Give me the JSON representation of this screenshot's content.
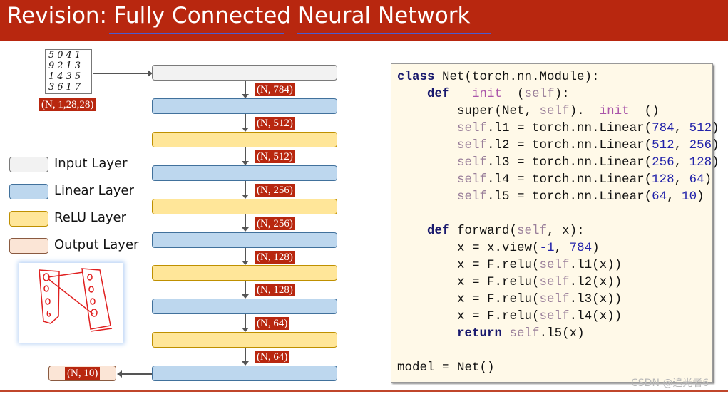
{
  "title": "Revision: Fully Connected Neural Network",
  "input_image": {
    "digit_rows": [
      "5041",
      "9213",
      "1435",
      "3617"
    ],
    "shape_label": "(N, 1,28,28)"
  },
  "layers": [
    {
      "type": "input"
    },
    {
      "type": "linear"
    },
    {
      "type": "relu"
    },
    {
      "type": "linear"
    },
    {
      "type": "relu"
    },
    {
      "type": "linear"
    },
    {
      "type": "relu"
    },
    {
      "type": "linear"
    },
    {
      "type": "relu"
    },
    {
      "type": "linear"
    }
  ],
  "shape_labels": [
    "(N, 784)",
    "(N, 512)",
    "(N, 512)",
    "(N, 256)",
    "(N, 256)",
    "(N, 128)",
    "(N, 128)",
    "(N, 64)",
    "(N, 64)"
  ],
  "output_label": "(N, 10)",
  "legend": [
    {
      "type": "input",
      "label": "Input Layer"
    },
    {
      "type": "linear",
      "label": "Linear Layer"
    },
    {
      "type": "relu",
      "label": "ReLU Layer"
    },
    {
      "type": "output",
      "label": "Output Layer"
    }
  ],
  "colors": {
    "title_bar": "#B8270F",
    "input": "#F2F2F2",
    "linear": "#BDD7EE",
    "relu": "#FFE699",
    "output": "#FBE5D6",
    "tag": "#B8270F",
    "sketch_ink": "#E02020"
  },
  "code": {
    "lines": [
      [
        [
          "class",
          "kw"
        ],
        [
          " Net(torch.nn.Module):",
          "plain"
        ]
      ],
      [
        [
          "    ",
          "plain"
        ],
        [
          "def",
          "kw"
        ],
        [
          " ",
          "plain"
        ],
        [
          "__init__",
          "dunder"
        ],
        [
          "(",
          "plain"
        ],
        [
          "self",
          "self"
        ],
        [
          "):",
          "plain"
        ]
      ],
      [
        [
          "        super(Net, ",
          "plain"
        ],
        [
          "self",
          "self"
        ],
        [
          ").",
          "plain"
        ],
        [
          "__init__",
          "dunder"
        ],
        [
          "()",
          "plain"
        ]
      ],
      [
        [
          "        ",
          "plain"
        ],
        [
          "self",
          "self"
        ],
        [
          ".l1 = torch.nn.Linear(",
          "plain"
        ],
        [
          "784",
          "num"
        ],
        [
          ", ",
          "plain"
        ],
        [
          "512",
          "num"
        ],
        [
          ")",
          "plain"
        ]
      ],
      [
        [
          "        ",
          "plain"
        ],
        [
          "self",
          "self"
        ],
        [
          ".l2 = torch.nn.Linear(",
          "plain"
        ],
        [
          "512",
          "num"
        ],
        [
          ", ",
          "plain"
        ],
        [
          "256",
          "num"
        ],
        [
          ")",
          "plain"
        ]
      ],
      [
        [
          "        ",
          "plain"
        ],
        [
          "self",
          "self"
        ],
        [
          ".l3 = torch.nn.Linear(",
          "plain"
        ],
        [
          "256",
          "num"
        ],
        [
          ", ",
          "plain"
        ],
        [
          "128",
          "num"
        ],
        [
          ")",
          "plain"
        ]
      ],
      [
        [
          "        ",
          "plain"
        ],
        [
          "self",
          "self"
        ],
        [
          ".l4 = torch.nn.Linear(",
          "plain"
        ],
        [
          "128",
          "num"
        ],
        [
          ", ",
          "plain"
        ],
        [
          "64",
          "num"
        ],
        [
          ")",
          "plain"
        ]
      ],
      [
        [
          "        ",
          "plain"
        ],
        [
          "self",
          "self"
        ],
        [
          ".l5 = torch.nn.Linear(",
          "plain"
        ],
        [
          "64",
          "num"
        ],
        [
          ", ",
          "plain"
        ],
        [
          "10",
          "num"
        ],
        [
          ")",
          "plain"
        ]
      ],
      [],
      [
        [
          "    ",
          "plain"
        ],
        [
          "def",
          "kw"
        ],
        [
          " forward(",
          "plain"
        ],
        [
          "self",
          "self"
        ],
        [
          ", x):",
          "plain"
        ]
      ],
      [
        [
          "        x = x.view(",
          "plain"
        ],
        [
          "-1",
          "num"
        ],
        [
          ", ",
          "plain"
        ],
        [
          "784",
          "num"
        ],
        [
          ")",
          "plain"
        ]
      ],
      [
        [
          "        x = F.relu(",
          "plain"
        ],
        [
          "self",
          "self"
        ],
        [
          ".l1(x))",
          "plain"
        ]
      ],
      [
        [
          "        x = F.relu(",
          "plain"
        ],
        [
          "self",
          "self"
        ],
        [
          ".l2(x))",
          "plain"
        ]
      ],
      [
        [
          "        x = F.relu(",
          "plain"
        ],
        [
          "self",
          "self"
        ],
        [
          ".l3(x))",
          "plain"
        ]
      ],
      [
        [
          "        x = F.relu(",
          "plain"
        ],
        [
          "self",
          "self"
        ],
        [
          ".l4(x))",
          "plain"
        ]
      ],
      [
        [
          "        ",
          "plain"
        ],
        [
          "return",
          "kw"
        ],
        [
          " ",
          "plain"
        ],
        [
          "self",
          "self"
        ],
        [
          ".l5(x)",
          "plain"
        ]
      ],
      [],
      [
        [
          "model = Net()",
          "plain"
        ]
      ]
    ]
  },
  "watermark": "CSDN @追光者6"
}
